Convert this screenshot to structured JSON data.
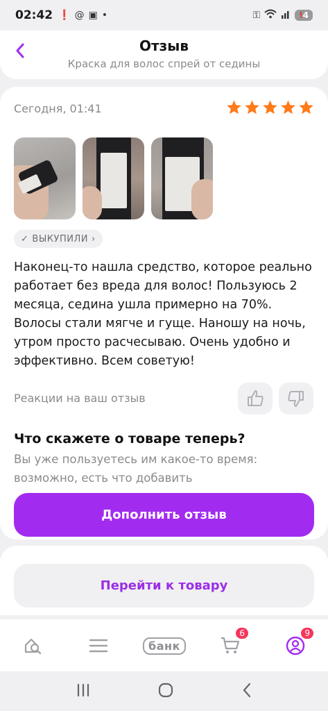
{
  "status_bar": {
    "time": "02:42",
    "battery": "4"
  },
  "header": {
    "title": "Отзыв",
    "subtitle": "Краска для волос спрей от седины"
  },
  "review": {
    "date": "Сегодня, 01:41",
    "rating": 5,
    "rating_max": 5,
    "photos_count": 3,
    "badge_label": "ВЫКУПИЛИ",
    "text": "Наконец-то нашла средство, которое реально работает без вреда для волос! Пользуюсь 2 месяца, седина ушла примерно на 70%. Волосы стали мягче и гуще. Наношу на ночь, утром просто расчесываю. Очень удобно и эффективно. Всем советую!",
    "reactions_label": "Реакции на ваш отзыв"
  },
  "prompt": {
    "title": "Что скажете о товаре теперь?",
    "text": "Вы уже пользуетесь им какое-то время: возможно, есть что добавить",
    "button_label": "Дополнить отзыв"
  },
  "product": {
    "button_label": "Перейти к товару"
  },
  "tabbar": {
    "bank_label": "банк",
    "cart_count": "6",
    "profile_count": "9"
  },
  "colors": {
    "accent": "#a22bf0",
    "star": "#ff7a1a",
    "badge": "#f5365c"
  }
}
